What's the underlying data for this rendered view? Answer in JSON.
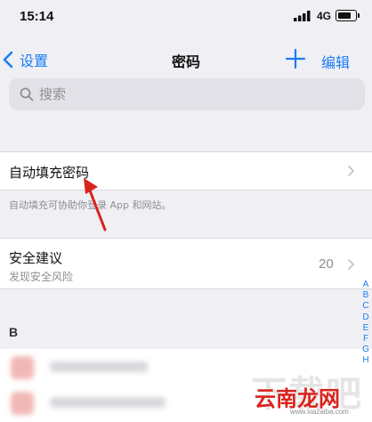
{
  "colors": {
    "accent": "#1a7cf5",
    "background": "#efeff4",
    "watermark_red": "#d9231e",
    "annotation_red": "#d9231e"
  },
  "status_bar": {
    "time": "15:14",
    "network": "4G",
    "battery_level": 0.8
  },
  "nav": {
    "back_label": "设置",
    "title": "密码",
    "add_icon": "plus-icon",
    "edit_label": "编辑"
  },
  "search": {
    "placeholder": "搜索",
    "value": ""
  },
  "autofill": {
    "label": "自动填充密码",
    "footer": "自动填充可协助你登录 App 和网站。"
  },
  "security": {
    "title": "安全建议",
    "subtitle": "发现安全风险",
    "count": "20"
  },
  "section_header": "B",
  "index_letters": [
    "A",
    "B",
    "C",
    "D",
    "E",
    "F",
    "G",
    "H"
  ],
  "watermark": {
    "main": "云南龙网",
    "url": "www.xiazaiba.com",
    "background_text": "下载吧"
  }
}
